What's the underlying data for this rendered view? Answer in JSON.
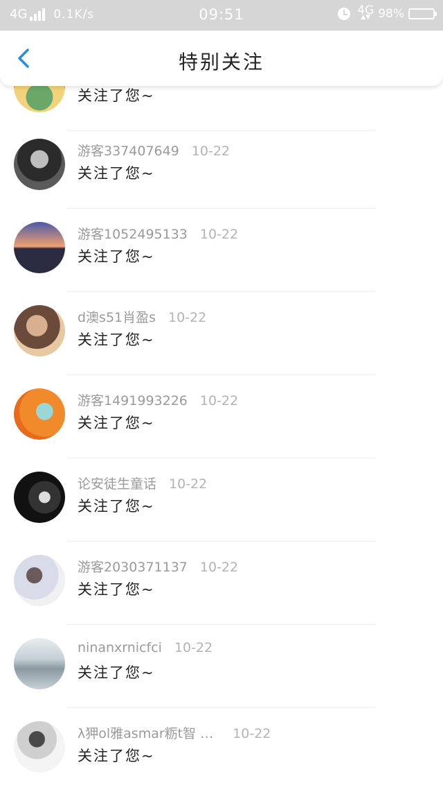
{
  "status_bar": {
    "network": "4G",
    "speed": "0.1K/s",
    "time": "09:51",
    "network_right": "4G",
    "battery": "98%"
  },
  "header": {
    "back_icon": "chevron-left-icon",
    "title": "特别关注"
  },
  "list": {
    "items": [
      {
        "name": "",
        "date": "",
        "action": "关注了您~",
        "avatar_colors": [
          "#f2d27a",
          "#6aa86a",
          "#e8b44a"
        ]
      },
      {
        "name": "游客337407649",
        "date": "10-22",
        "action": "关注了您~",
        "avatar_colors": [
          "#2b2b2b",
          "#bdbdbd",
          "#5a5a5a"
        ]
      },
      {
        "name": "游客1052495133",
        "date": "10-22",
        "action": "关注了您~",
        "avatar_colors": [
          "#4a5aa8",
          "#f0a070",
          "#2a2a40"
        ]
      },
      {
        "name": "d澳s51肖盈s",
        "date": "10-22",
        "action": "关注了您~",
        "avatar_colors": [
          "#e8c8a0",
          "#6a4a3a",
          "#d8b090"
        ]
      },
      {
        "name": "游客1491993226",
        "date": "10-22",
        "action": "关注了您~",
        "avatar_colors": [
          "#f08a2a",
          "#9ad8d8",
          "#e86a1a"
        ]
      },
      {
        "name": "论安徒生童话",
        "date": "10-22",
        "action": "关注了您~",
        "avatar_colors": [
          "#111111",
          "#dddddd",
          "#333333"
        ]
      },
      {
        "name": "游客2030371137",
        "date": "10-22",
        "action": "关注了您~",
        "avatar_colors": [
          "#d8dce8",
          "#6a5a5a",
          "#f0f0f0"
        ]
      },
      {
        "name": "ninanxrnicfci",
        "date": "10-22",
        "action": "关注了您~",
        "avatar_colors": [
          "#c8d0d8",
          "#8a9aa0",
          "#e8ecef"
        ]
      },
      {
        "name": "λ狎ol雅asmar粝t智 …",
        "date": "10-22",
        "action": "关注了您~",
        "avatar_colors": [
          "#f4f4f4",
          "#4a4a4a",
          "#cfcfcf"
        ]
      }
    ]
  }
}
